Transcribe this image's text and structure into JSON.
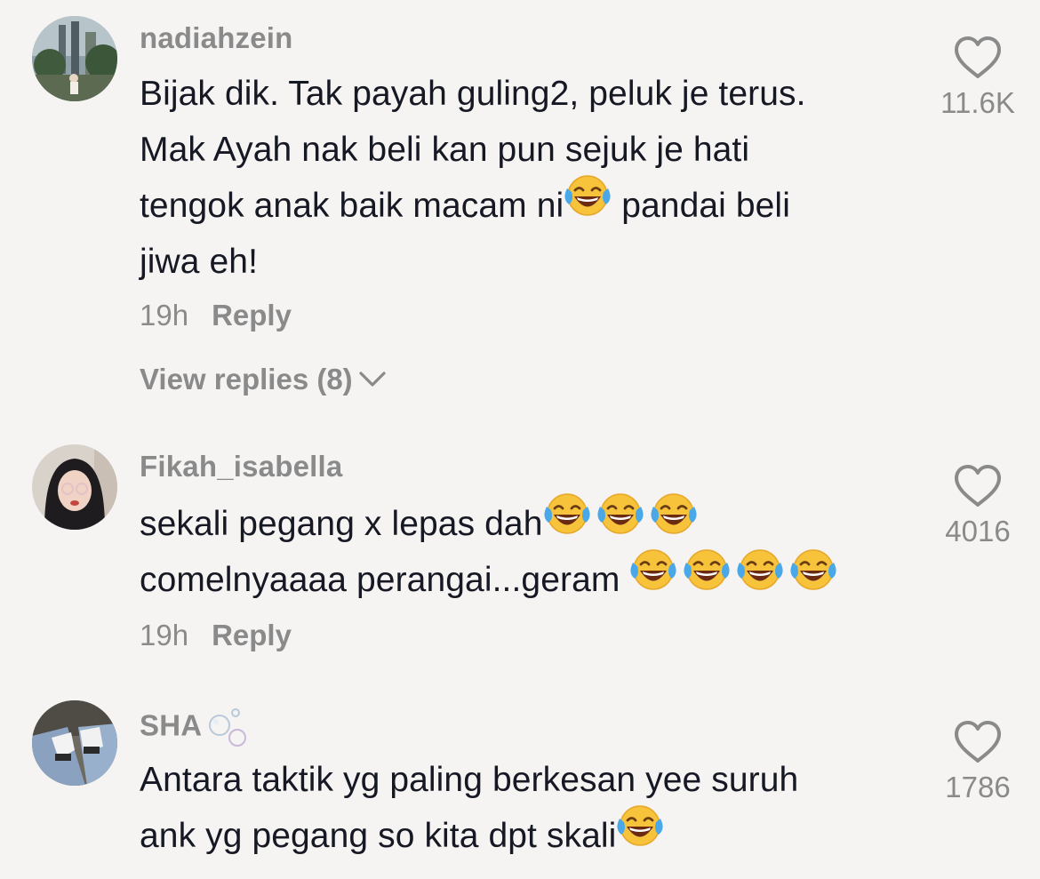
{
  "comments": [
    {
      "username": "nadiahzein",
      "lines": [
        [
          "Bijak dik. Tak payah guling2, peluk je terus."
        ],
        [
          "Mak Ayah nak beli kan pun sejuk je hati"
        ],
        [
          "tengok anak baik macam ni",
          " pandai beli"
        ],
        [
          "jiwa eh!"
        ]
      ],
      "time": "19h",
      "reply_label": "Reply",
      "view_replies": "View replies (8)",
      "likes": "11.6K",
      "heart_icon": "heart-outline-icon"
    },
    {
      "username": "Fikah_isabella",
      "lines": [
        [
          "sekali pegang x lepas dah"
        ],
        [
          "comelnyaaaa perangai...geram "
        ]
      ],
      "time": "19h",
      "reply_label": "Reply",
      "likes": "4016",
      "heart_icon": "heart-outline-icon"
    },
    {
      "username": "SHA",
      "lines": [
        [
          "Antara taktik yg paling berkesan yee suruh"
        ],
        [
          "ank yg pegang so kita dpt skali"
        ]
      ],
      "likes": "1786",
      "heart_icon": "heart-outline-icon"
    }
  ],
  "colors": {
    "background": "#f5f4f3",
    "text": "#161823",
    "muted": "#8a8a8a"
  },
  "emoji_name": "face-with-tears-of-joy"
}
